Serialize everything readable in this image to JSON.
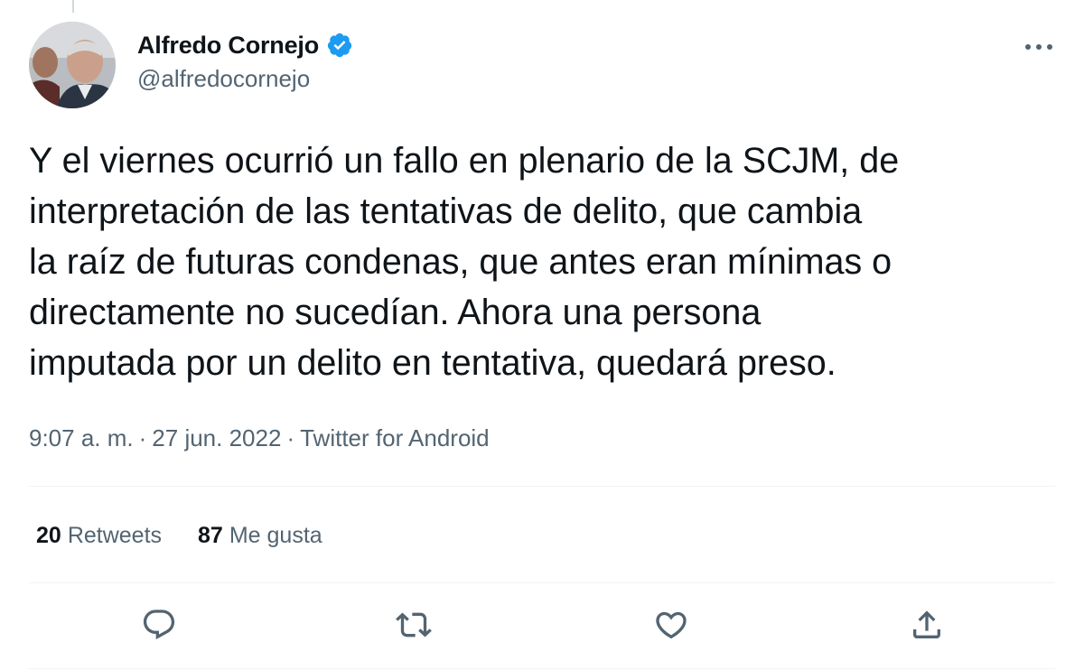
{
  "author": {
    "display_name": "Alfredo Cornejo",
    "handle": "@alfredocornejo",
    "verified": true,
    "avatar": "profile-photo"
  },
  "tweet": {
    "text": "Y el viernes ocurrió un fallo en plenario de la SCJM, de\ninterpretación de las tentativas de delito, que cambia\nla raíz de futuras condenas, que antes eran mínimas o\ndirectamente no sucedían. Ahora una persona\nimputada por un delito en tentativa, quedará preso.",
    "time": "9:07 a. m.",
    "separator": "·",
    "date": "27 jun. 2022",
    "source": "Twitter for Android"
  },
  "stats": {
    "retweets_count": "20",
    "retweets_label": "Retweets",
    "likes_count": "87",
    "likes_label": "Me gusta"
  },
  "actions": [
    "reply-icon",
    "retweet-icon",
    "like-icon",
    "share-icon"
  ],
  "colors": {
    "text_primary": "#0f1419",
    "text_secondary": "#536471",
    "verified_blue": "#1d9bf0",
    "divider": "#eff3f4"
  }
}
